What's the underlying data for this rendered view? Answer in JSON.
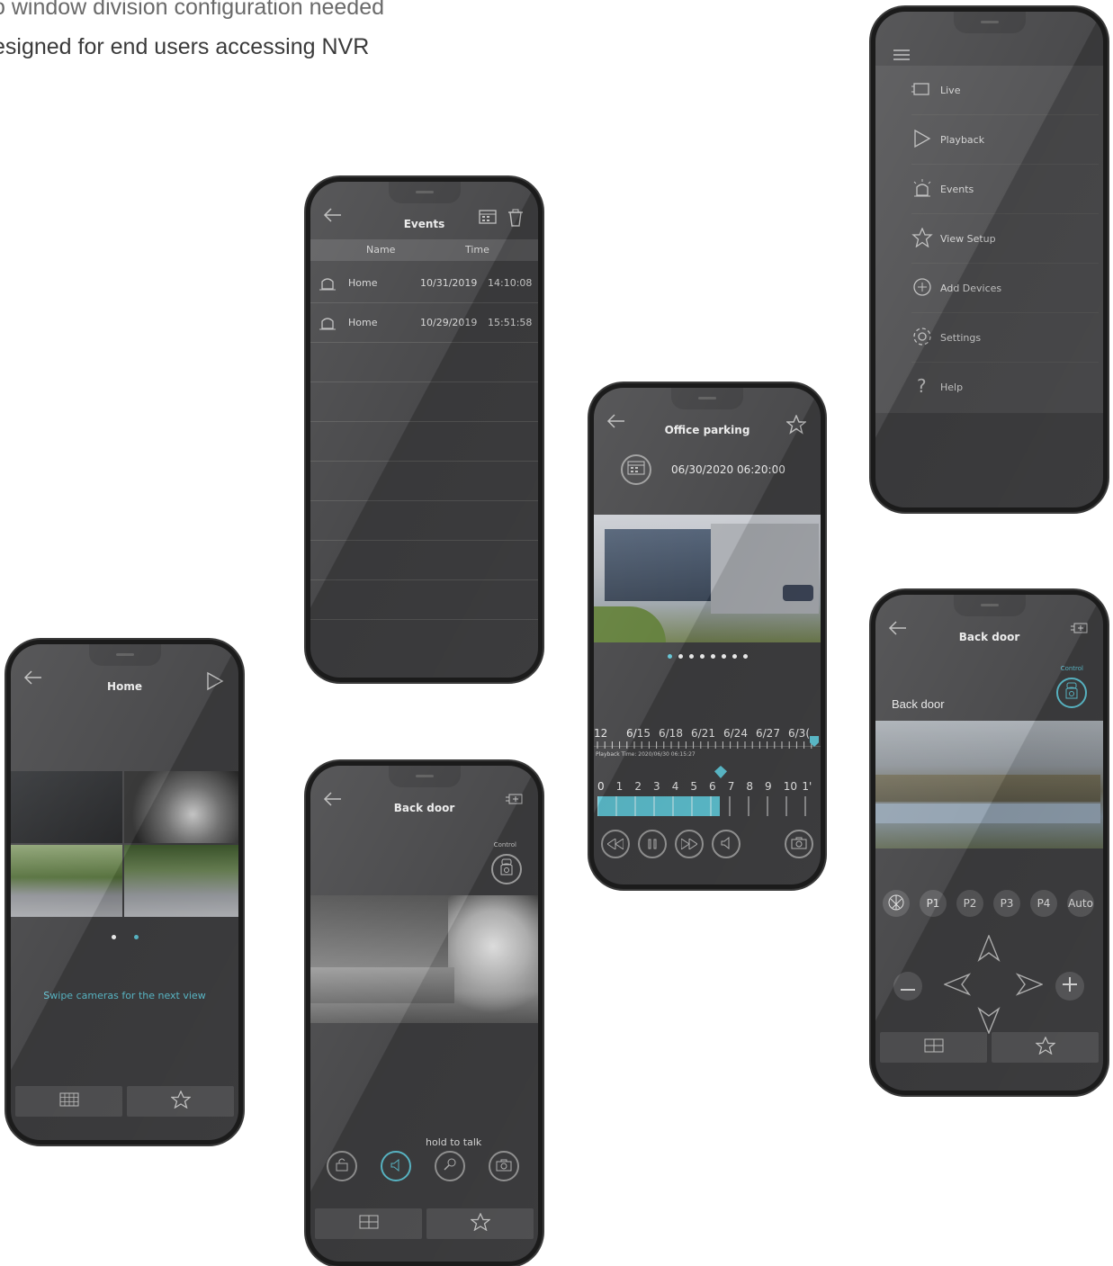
{
  "headlines": {
    "line1": "o window division configuration needed",
    "line2": "esigned for end users accessing NVR"
  },
  "menu_screen": {
    "items": [
      {
        "label": "Live",
        "icon": "camera-icon"
      },
      {
        "label": "Playback",
        "icon": "play-icon"
      },
      {
        "label": "Events",
        "icon": "alarm-icon"
      },
      {
        "label": "View Setup",
        "icon": "star-icon"
      },
      {
        "label": "Add Devices",
        "icon": "plus-circle-icon"
      },
      {
        "label": "Settings",
        "icon": "gear-icon"
      },
      {
        "label": "Help",
        "icon": "question-icon"
      }
    ]
  },
  "events_screen": {
    "title": "Events",
    "col_name": "Name",
    "col_time": "Time",
    "rows": [
      {
        "name": "Home",
        "date": "10/31/2019",
        "time": "14:10:08"
      },
      {
        "name": "Home",
        "date": "10/29/2019",
        "time": "15:51:58"
      }
    ]
  },
  "playback_screen": {
    "title": "Office parking",
    "datetime": "06/30/2020 06:20:00",
    "date_ticks": [
      "12",
      "6/15",
      "6/18",
      "6/21",
      "6/24",
      "6/27",
      "6/3("
    ],
    "playback_time": "Playback Time: 2020/06/30 06:15:27",
    "hour_ticks": [
      "0",
      "1",
      "2",
      "3",
      "4",
      "5",
      "6",
      "7",
      "8",
      "9",
      "10",
      "1'"
    ],
    "page_dots": 8,
    "active_dot": 0
  },
  "home_screen": {
    "title": "Home",
    "hint": "Swipe cameras for the next view",
    "page_dots": 2,
    "active_dot": 1
  },
  "backdoor_screen_1": {
    "title": "Back door",
    "control_label": "Control",
    "hold_label": "hold to talk"
  },
  "backdoor_screen_2": {
    "title": "Back door",
    "control_label": "Control",
    "camera_label": "Back door",
    "presets": [
      "P1",
      "P2",
      "P3",
      "P4",
      "Auto"
    ]
  },
  "colors": {
    "accent": "#5fc3d3",
    "screen_bg": "#3f3f41",
    "bar_bg": "#545456"
  }
}
